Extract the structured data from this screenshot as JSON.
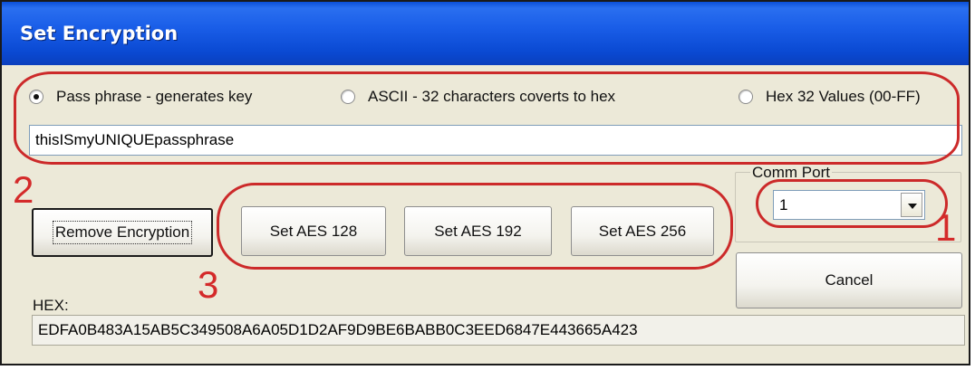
{
  "window": {
    "title": "Set Encryption"
  },
  "key_type_options": [
    {
      "label": "Pass phrase - generates key",
      "selected": true
    },
    {
      "label": "ASCII - 32 characters coverts to hex",
      "selected": false
    },
    {
      "label": "Hex 32 Values (00-FF)",
      "selected": false
    }
  ],
  "key_input": {
    "value": "thisISmyUNIQUEpassphrase"
  },
  "buttons": {
    "remove_encryption": "Remove Encryption",
    "set_aes_128": "Set AES 128",
    "set_aes_192": "Set AES 192",
    "set_aes_256": "Set AES 256",
    "cancel": "Cancel"
  },
  "comm_port": {
    "label": "Comm Port",
    "value": "1"
  },
  "hex": {
    "label": "HEX:",
    "value": "EDFA0B483A15AB5C349508A6A05D1D2AF9D9BE6BABB0C3EED6847E443665A423"
  },
  "annotations": {
    "step_1": "1",
    "step_2": "2",
    "step_3": "3",
    "color": "#cc2a2a"
  }
}
